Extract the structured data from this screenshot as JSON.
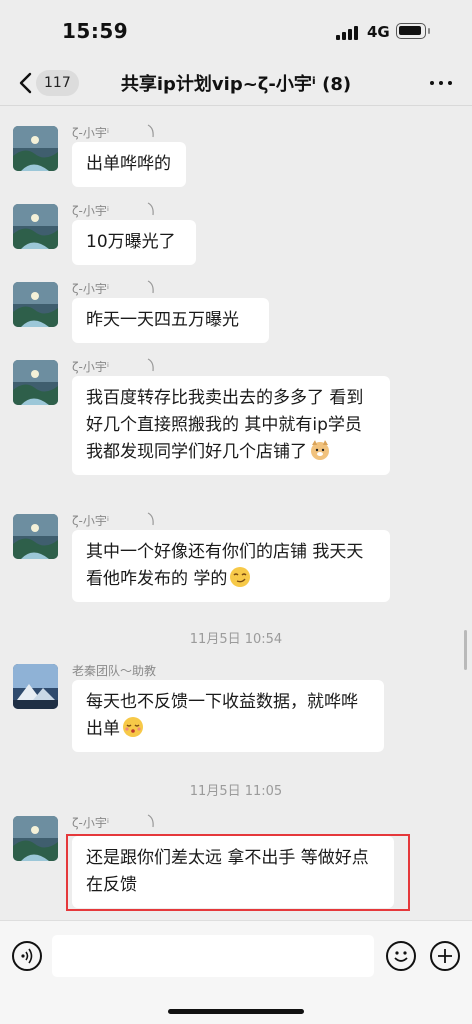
{
  "status_bar": {
    "time": "15:59",
    "network": "4G"
  },
  "header": {
    "unread_count": "117",
    "title": "共享ip计划vip~ζ-小宇ⁱ (8)"
  },
  "messages": [
    {
      "sender": "ζ-小宇ⁱ",
      "text": "出单哗哗的"
    },
    {
      "sender": "ζ-小宇ⁱ",
      "text": "10万曝光了"
    },
    {
      "sender": "ζ-小宇ⁱ",
      "text": "昨天一天四五万曝光"
    },
    {
      "sender": "ζ-小宇ⁱ",
      "text": "我百度转存比我卖出去的多多了 看到好几个直接照搬我的 其中就有ip学员 我都发现同学们好几个店铺了",
      "emoji": "doge-emoji"
    },
    {
      "sender": "ζ-小宇ⁱ",
      "text": "其中一个好像还有你们的店铺 我天天看他咋发布的 学的",
      "emoji": "smirk-emoji"
    },
    {
      "sender": "老秦团队～助教",
      "text": "每天也不反馈一下收益数据，就哗哗出单",
      "emoji": "whistle-emoji"
    },
    {
      "sender": "ζ-小宇ⁱ",
      "text": "还是跟你们差太远 拿不出手 等做好点 在反馈"
    }
  ],
  "timestamps": [
    "11月5日 10:54",
    "11月5日 11:05"
  ],
  "input_bar": {
    "value": "",
    "placeholder": ""
  },
  "icons": [
    "back-chevron-icon",
    "more-dots-icon",
    "voice-icon",
    "emoji-icon",
    "plus-icon"
  ],
  "colors": {
    "background": "#ededed",
    "bubble": "#ffffff",
    "highlight": "#e5383b",
    "timestamp": "#9b9b9b"
  }
}
